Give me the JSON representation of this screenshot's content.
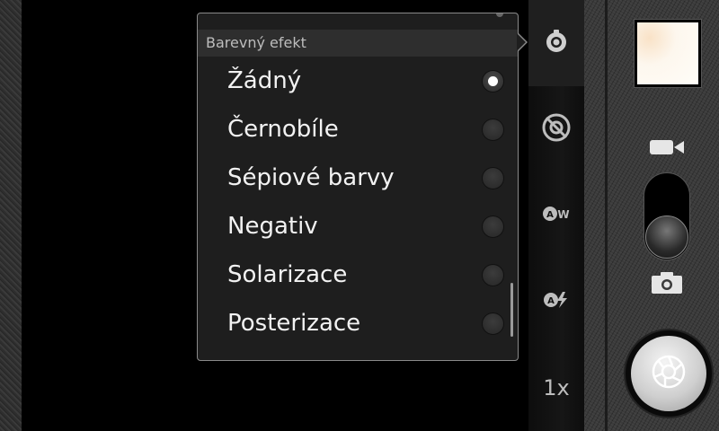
{
  "effect_menu": {
    "title": "Barevný efekt",
    "options": [
      {
        "label": "Žádný",
        "selected": true
      },
      {
        "label": "Černobíle",
        "selected": false
      },
      {
        "label": "Sépiové barvy",
        "selected": false
      },
      {
        "label": "Negativ",
        "selected": false
      },
      {
        "label": "Solarizace",
        "selected": false
      },
      {
        "label": "Posterizace",
        "selected": false
      }
    ]
  },
  "settings_bar": {
    "items": [
      {
        "icon": "color-effect-icon",
        "active": true
      },
      {
        "icon": "scene-mode-icon",
        "active": false
      },
      {
        "icon": "auto-white-balance-icon",
        "active": false
      },
      {
        "icon": "auto-flash-icon",
        "active": false
      }
    ],
    "zoom_label": "1x"
  },
  "controls": {
    "mode_switch": "photo",
    "video_icon": "video-camera-icon",
    "photo_icon": "camera-icon",
    "shutter_icon": "aperture-icon"
  }
}
